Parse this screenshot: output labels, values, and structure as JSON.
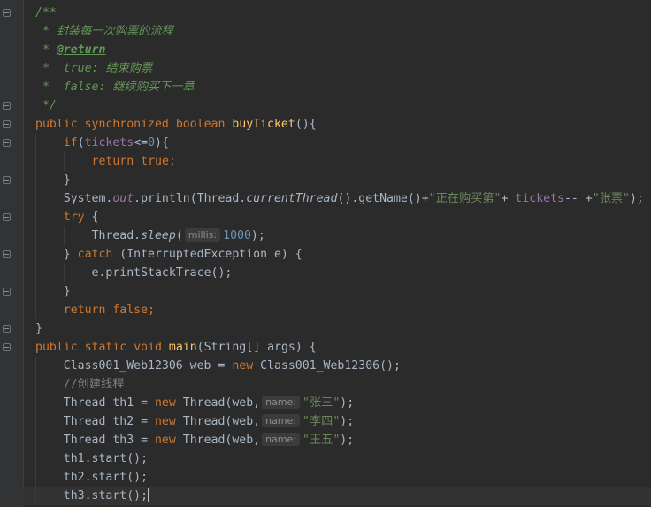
{
  "lines": {
    "l1": "/**",
    "l2": " * 封装每一次购票的流程",
    "l3_prefix": " * ",
    "l3_tag": "@return",
    "l4_prefix": " *  ",
    "l4_text": "true: 结束购票",
    "l5_prefix": " *  ",
    "l5_text": "false: 继续购买下一章",
    "l6": " */",
    "l7_public": "public",
    "l7_synchronized": "synchronized",
    "l7_boolean": "boolean",
    "l7_method": "buyTicket",
    "l7_rest": "(){",
    "l8_if": "if",
    "l8_open": "(",
    "l8_field": "tickets",
    "l8_op": "<=",
    "l8_num": "0",
    "l8_close": "){",
    "l9_return": "return",
    "l9_true": "true",
    "l9_semi": ";",
    "l10": "}",
    "l11_system": "System.",
    "l11_out": "out",
    "l11_println": ".println(Thread.",
    "l11_current": "currentThread",
    "l11_getname": "().getName()+",
    "l11_str1": "\"正在购买第\"",
    "l11_plus": "+ ",
    "l11_tickets": "tickets",
    "l11_dec": "-- +",
    "l11_str2": "\"张票\"",
    "l11_end": ");",
    "l12_try": "try",
    "l12_brace": " {",
    "l13_thread": "Thread.",
    "l13_sleep": "sleep",
    "l13_open": "(",
    "l13_hint": "millis:",
    "l13_num": "1000",
    "l13_end": ");",
    "l14_close": "} ",
    "l14_catch": "catch",
    "l14_rest": " (InterruptedException e) {",
    "l15": "e.printStackTrace();",
    "l16": "}",
    "l17_return": "return",
    "l17_false": "false",
    "l17_semi": ";",
    "l18": "}",
    "l19_public": "public",
    "l19_static": "static",
    "l19_void": "void",
    "l19_main": "main",
    "l19_rest": "(String[] args) {",
    "l20_decl": "Class001_Web12306 web = ",
    "l20_new": "new",
    "l20_rest": " Class001_Web12306();",
    "l21": "//创建线程",
    "l22_decl": "Thread th1 = ",
    "l22_new": "new",
    "l22_ctor": " Thread(web,",
    "l22_hint": "name:",
    "l22_str": "\"张三\"",
    "l22_end": ");",
    "l23_decl": "Thread th2 = ",
    "l23_new": "new",
    "l23_ctor": " Thread(web,",
    "l23_hint": "name:",
    "l23_str": "\"李四\"",
    "l23_end": ");",
    "l24_decl": "Thread th3 = ",
    "l24_new": "new",
    "l24_ctor": " Thread(web,",
    "l24_hint": "name:",
    "l24_str": "\"王五\"",
    "l24_end": ");",
    "l25": "th1.start();",
    "l26": "th2.start();",
    "l27": "th3.start();"
  },
  "colors": {
    "background": "#2b2b2b",
    "keyword": "#cc7832",
    "method": "#ffc66d",
    "number": "#6897bb",
    "string": "#6a8759",
    "field": "#9876aa",
    "doc_comment": "#629755",
    "line_comment": "#808080",
    "default_text": "#a9b7c6"
  }
}
